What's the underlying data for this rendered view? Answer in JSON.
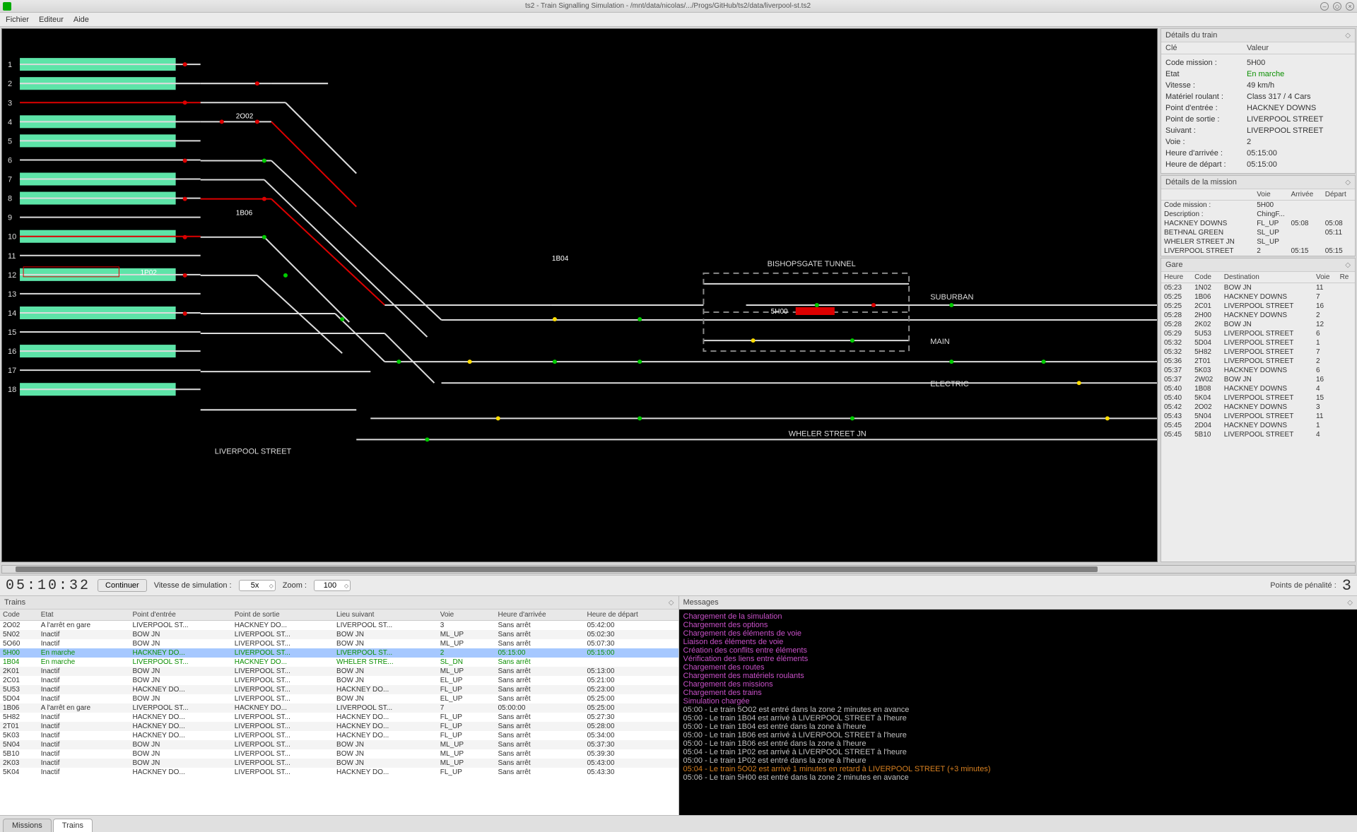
{
  "title": "ts2 - Train Signalling Simulation - /mnt/data/nicolas/.../Progs/GitHub/ts2/data/liverpool-st.ts2",
  "menus": [
    "Fichier",
    "Editeur",
    "Aide"
  ],
  "track_labels": {
    "station": "LIVERPOOL STREET",
    "tunnel": "BISHOPSGATE TUNNEL",
    "suburban": "SUBURBAN",
    "main": "MAIN",
    "electric": "ELECTRIC",
    "wheler": "WHELER STREET JN"
  },
  "track_trains": {
    "t2o02": "2O02",
    "t1b06": "1B06",
    "t1p02": "1P02",
    "t1b04": "1B04",
    "t5h00": "5H00"
  },
  "platform_numbers": [
    "1",
    "2",
    "3",
    "4",
    "5",
    "6",
    "7",
    "8",
    "9",
    "10",
    "11",
    "12",
    "13",
    "14",
    "15",
    "16",
    "17",
    "18"
  ],
  "clock": "05:10:32",
  "btn_continue": "Continuer",
  "sim_speed_label": "Vitesse de simulation :",
  "sim_speed": "5x",
  "zoom_label": "Zoom :",
  "zoom": "100",
  "penalty_label": "Points de pénalité :",
  "penalty": "3",
  "details_train": {
    "title": "Détails du train",
    "head_key": "Clé",
    "head_val": "Valeur",
    "rows": [
      {
        "k": "Code mission :",
        "v": "5H00"
      },
      {
        "k": "Etat",
        "v": "En marche",
        "green": true
      },
      {
        "k": "Vitesse :",
        "v": "49 km/h"
      },
      {
        "k": "Matériel roulant :",
        "v": "Class 317 / 4 Cars"
      },
      {
        "k": "",
        "v": ""
      },
      {
        "k": "Point d'entrée :",
        "v": "HACKNEY DOWNS"
      },
      {
        "k": "Point de sortie :",
        "v": "LIVERPOOL STREET"
      },
      {
        "k": "",
        "v": ""
      },
      {
        "k": "Suivant :",
        "v": "LIVERPOOL STREET"
      },
      {
        "k": "Voie :",
        "v": "2"
      },
      {
        "k": "Heure d'arrivée :",
        "v": "05:15:00"
      },
      {
        "k": "Heure de départ :",
        "v": "05:15:00"
      }
    ]
  },
  "details_mission": {
    "title": "Détails de la mission",
    "head": [
      "",
      "Voie",
      "Arrivée",
      "Départ"
    ],
    "info": [
      {
        "k": "Code mission :",
        "v": "5H00"
      },
      {
        "k": "Description :",
        "v": "ChingF..."
      }
    ],
    "stops": [
      {
        "n": "HACKNEY DOWNS",
        "voie": "FL_UP",
        "arr": "05:08",
        "dep": "05:08"
      },
      {
        "n": "BETHNAL GREEN",
        "voie": "SL_UP",
        "arr": "",
        "dep": "05:11"
      },
      {
        "n": "WHELER STREET JN",
        "voie": "SL_UP",
        "arr": "",
        "dep": ""
      },
      {
        "n": "LIVERPOOL STREET",
        "voie": "2",
        "arr": "05:15",
        "dep": "05:15"
      }
    ]
  },
  "gare": {
    "title": "Gare",
    "head": [
      "Heure",
      "Code",
      "Destination",
      "Voie",
      "Re"
    ],
    "rows": [
      {
        "h": "05:23",
        "c": "1N02",
        "d": "BOW JN",
        "v": "11"
      },
      {
        "h": "05:25",
        "c": "1B06",
        "d": "HACKNEY DOWNS",
        "v": "7"
      },
      {
        "h": "05:25",
        "c": "2C01",
        "d": "LIVERPOOL STREET",
        "v": "16"
      },
      {
        "h": "05:28",
        "c": "2H00",
        "d": "HACKNEY DOWNS",
        "v": "2"
      },
      {
        "h": "05:28",
        "c": "2K02",
        "d": "BOW JN",
        "v": "12"
      },
      {
        "h": "05:29",
        "c": "5U53",
        "d": "LIVERPOOL STREET",
        "v": "6"
      },
      {
        "h": "05:32",
        "c": "5D04",
        "d": "LIVERPOOL STREET",
        "v": "1"
      },
      {
        "h": "05:32",
        "c": "5H82",
        "d": "LIVERPOOL STREET",
        "v": "7"
      },
      {
        "h": "05:36",
        "c": "2T01",
        "d": "LIVERPOOL STREET",
        "v": "2"
      },
      {
        "h": "05:37",
        "c": "5K03",
        "d": "HACKNEY DOWNS",
        "v": "6"
      },
      {
        "h": "05:37",
        "c": "2W02",
        "d": "BOW JN",
        "v": "16"
      },
      {
        "h": "05:40",
        "c": "1B08",
        "d": "HACKNEY DOWNS",
        "v": "4"
      },
      {
        "h": "05:40",
        "c": "5K04",
        "d": "LIVERPOOL STREET",
        "v": "15"
      },
      {
        "h": "05:42",
        "c": "2O02",
        "d": "HACKNEY DOWNS",
        "v": "3"
      },
      {
        "h": "05:43",
        "c": "5N04",
        "d": "LIVERPOOL STREET",
        "v": "11"
      },
      {
        "h": "05:45",
        "c": "2D04",
        "d": "HACKNEY DOWNS",
        "v": "1"
      },
      {
        "h": "05:45",
        "c": "5B10",
        "d": "LIVERPOOL STREET",
        "v": "4"
      }
    ]
  },
  "trains_panel_title": "Trains",
  "trains_head": [
    "Code",
    "Etat",
    "Point d'entrée",
    "Point de sortie",
    "Lieu suivant",
    "Voie",
    "",
    "Heure d'arrivée",
    "Heure de départ"
  ],
  "trains_rows": [
    {
      "c": "2O02",
      "e": "A l'arrêt en gare",
      "pi": "LIVERPOOL ST...",
      "po": "HACKNEY DO...",
      "ls": "LIVERPOOL ST...",
      "v": "3",
      "ha": "",
      "hd": "05:42:00"
    },
    {
      "c": "5N02",
      "e": "Inactif",
      "pi": "BOW JN",
      "po": "LIVERPOOL ST...",
      "ls": "BOW JN",
      "v": "ML_UP",
      "ha": "",
      "hd": "05:02:30"
    },
    {
      "c": "5O60",
      "e": "Inactif",
      "pi": "BOW JN",
      "po": "LIVERPOOL ST...",
      "ls": "BOW JN",
      "v": "ML_UP",
      "ha": "",
      "hd": "05:07:30"
    },
    {
      "c": "5H00",
      "e": "En marche",
      "pi": "HACKNEY DO...",
      "po": "LIVERPOOL ST...",
      "ls": "LIVERPOOL ST...",
      "v": "2",
      "ha": "05:15:00",
      "hd": "05:15:00",
      "sel": true,
      "green": true
    },
    {
      "c": "1B04",
      "e": "En marche",
      "pi": "LIVERPOOL ST...",
      "po": "HACKNEY DO...",
      "ls": "WHELER STRE...",
      "v": "SL_DN",
      "ha": "Sans arrêt",
      "hd": "",
      "green": true
    },
    {
      "c": "2K01",
      "e": "Inactif",
      "pi": "BOW JN",
      "po": "LIVERPOOL ST...",
      "ls": "BOW JN",
      "v": "ML_UP",
      "ha": "",
      "hd": "05:13:00"
    },
    {
      "c": "2C01",
      "e": "Inactif",
      "pi": "BOW JN",
      "po": "LIVERPOOL ST...",
      "ls": "BOW JN",
      "v": "EL_UP",
      "ha": "",
      "hd": "05:21:00"
    },
    {
      "c": "5U53",
      "e": "Inactif",
      "pi": "HACKNEY DO...",
      "po": "LIVERPOOL ST...",
      "ls": "HACKNEY DO...",
      "v": "FL_UP",
      "ha": "",
      "hd": "05:23:00"
    },
    {
      "c": "5D04",
      "e": "Inactif",
      "pi": "BOW JN",
      "po": "LIVERPOOL ST...",
      "ls": "BOW JN",
      "v": "EL_UP",
      "ha": "Sans arrêt",
      "hd": "05:25:00"
    },
    {
      "c": "1B06",
      "e": "A l'arrêt en gare",
      "pi": "LIVERPOOL ST...",
      "po": "HACKNEY DO...",
      "ls": "LIVERPOOL ST...",
      "v": "7",
      "ha": "05:00:00",
      "hd": "05:25:00"
    },
    {
      "c": "5H82",
      "e": "Inactif",
      "pi": "HACKNEY DO...",
      "po": "LIVERPOOL ST...",
      "ls": "HACKNEY DO...",
      "v": "FL_UP",
      "ha": "",
      "hd": "05:27:30"
    },
    {
      "c": "2T01",
      "e": "Inactif",
      "pi": "HACKNEY DO...",
      "po": "LIVERPOOL ST...",
      "ls": "HACKNEY DO...",
      "v": "FL_UP",
      "ha": "",
      "hd": "05:28:00"
    },
    {
      "c": "5K03",
      "e": "Inactif",
      "pi": "HACKNEY DO...",
      "po": "LIVERPOOL ST...",
      "ls": "HACKNEY DO...",
      "v": "FL_UP",
      "ha": "",
      "hd": "05:34:00"
    },
    {
      "c": "5N04",
      "e": "Inactif",
      "pi": "BOW JN",
      "po": "LIVERPOOL ST...",
      "ls": "BOW JN",
      "v": "ML_UP",
      "ha": "",
      "hd": "05:37:30"
    },
    {
      "c": "5B10",
      "e": "Inactif",
      "pi": "BOW JN",
      "po": "LIVERPOOL ST...",
      "ls": "BOW JN",
      "v": "ML_UP",
      "ha": "",
      "hd": "05:39:30"
    },
    {
      "c": "2K03",
      "e": "Inactif",
      "pi": "BOW JN",
      "po": "LIVERPOOL ST...",
      "ls": "BOW JN",
      "v": "ML_UP",
      "ha": "",
      "hd": "05:43:00"
    },
    {
      "c": "5K04",
      "e": "Inactif",
      "pi": "HACKNEY DO...",
      "po": "LIVERPOOL ST...",
      "ls": "HACKNEY DO...",
      "v": "FL_UP",
      "ha": "",
      "hd": "05:43:30"
    }
  ],
  "tabs": [
    "Missions",
    "Trains"
  ],
  "messages_title": "Messages",
  "messages": [
    {
      "c": "m",
      "t": "Chargement de la simulation"
    },
    {
      "c": "m",
      "t": "Chargement des options"
    },
    {
      "c": "m",
      "t": "Chargement des éléments de voie"
    },
    {
      "c": "m",
      "t": "Liaison des éléments de voie"
    },
    {
      "c": "m",
      "t": "Création des conflits entre éléments"
    },
    {
      "c": "m",
      "t": "Vérification des liens entre éléments"
    },
    {
      "c": "m",
      "t": "Chargement des routes"
    },
    {
      "c": "m",
      "t": "Chargement des matériels roulants"
    },
    {
      "c": "m",
      "t": "Chargement des missions"
    },
    {
      "c": "m",
      "t": "Chargement des trains"
    },
    {
      "c": "m",
      "t": "Simulation chargée"
    },
    {
      "c": "g",
      "t": "05:00 - Le train 5O02 est entré dans la zone 2 minutes en avance"
    },
    {
      "c": "g",
      "t": "05:00 - Le train 1B04 est arrivé à LIVERPOOL STREET à l'heure"
    },
    {
      "c": "g",
      "t": "05:00 - Le train 1B04 est entré dans la zone à l'heure"
    },
    {
      "c": "g",
      "t": "05:00 - Le train 1B06 est arrivé à LIVERPOOL STREET à l'heure"
    },
    {
      "c": "g",
      "t": "05:00 - Le train 1B06 est entré dans la zone à l'heure"
    },
    {
      "c": "g",
      "t": "05:04 - Le train 1P02 est arrivé à LIVERPOOL STREET à l'heure"
    },
    {
      "c": "g",
      "t": "05:00 - Le train 1P02 est entré dans la zone à l'heure"
    },
    {
      "c": "o",
      "t": "05:04 - Le train 5O02 est arrivé 1 minutes en retard à LIVERPOOL STREET (+3 minutes)"
    },
    {
      "c": "g",
      "t": "05:06 - Le train 5H00 est entré dans la zone 2 minutes en avance"
    }
  ]
}
